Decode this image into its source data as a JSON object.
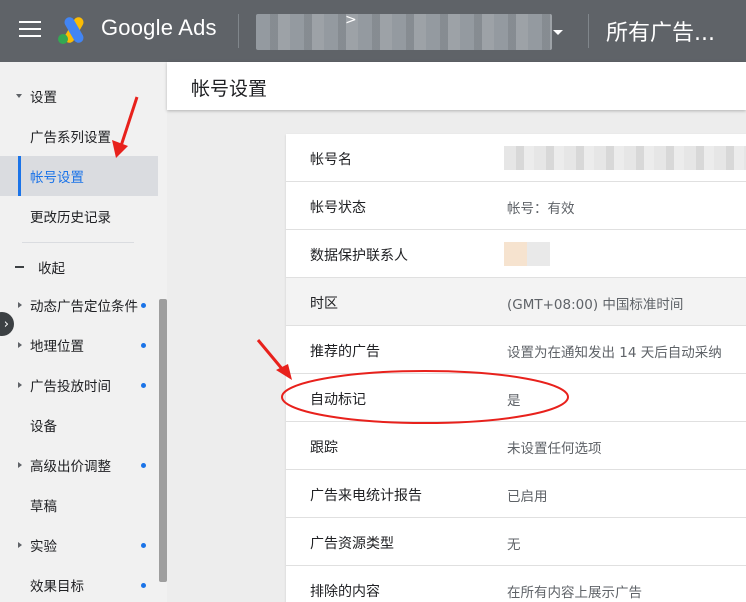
{
  "header": {
    "menu_icon": "hamburger-menu-icon",
    "brand": "Google Ads",
    "account_arrow": ">",
    "campaign_selector": "所有广告..."
  },
  "sidebar": {
    "settings_label": "设置",
    "items": [
      {
        "label": "广告系列设置"
      },
      {
        "label": "帐号设置",
        "active": true
      },
      {
        "label": "更改历史记录"
      }
    ],
    "collapse_label": "收起",
    "more_items": [
      {
        "label": "动态广告定位条件",
        "dot": true,
        "expandable": true
      },
      {
        "label": "地理位置",
        "dot": true,
        "expandable": true
      },
      {
        "label": "广告投放时间",
        "dot": true,
        "expandable": true
      },
      {
        "label": "设备",
        "dot": false,
        "expandable": false
      },
      {
        "label": "高级出价调整",
        "dot": true,
        "expandable": true
      },
      {
        "label": "草稿",
        "dot": false,
        "expandable": false
      },
      {
        "label": "实验",
        "dot": true,
        "expandable": true
      },
      {
        "label": "效果目标",
        "dot": true,
        "expandable": false
      }
    ]
  },
  "main": {
    "page_title": "帐号设置",
    "rows": [
      {
        "label": "帐号名",
        "value": ""
      },
      {
        "label": "帐号状态",
        "value": "帐号：有效"
      },
      {
        "label": "数据保护联系人",
        "value": ""
      },
      {
        "label": "时区",
        "value": "(GMT+08:00) 中国标准时间"
      },
      {
        "label": "推荐的广告",
        "value": "设置为在通知发出 14 天后自动采纳"
      },
      {
        "label": "自动标记",
        "value": "是"
      },
      {
        "label": "跟踪",
        "value": "未设置任何选项"
      },
      {
        "label": "广告来电统计报告",
        "value": "已启用"
      },
      {
        "label": "广告资源类型",
        "value": "无"
      },
      {
        "label": "排除的内容",
        "value": "在所有内容上展示广告"
      }
    ]
  },
  "colors": {
    "topbar": "#5f6368",
    "accent": "#1a73e8",
    "annotation": "#e8211c"
  }
}
